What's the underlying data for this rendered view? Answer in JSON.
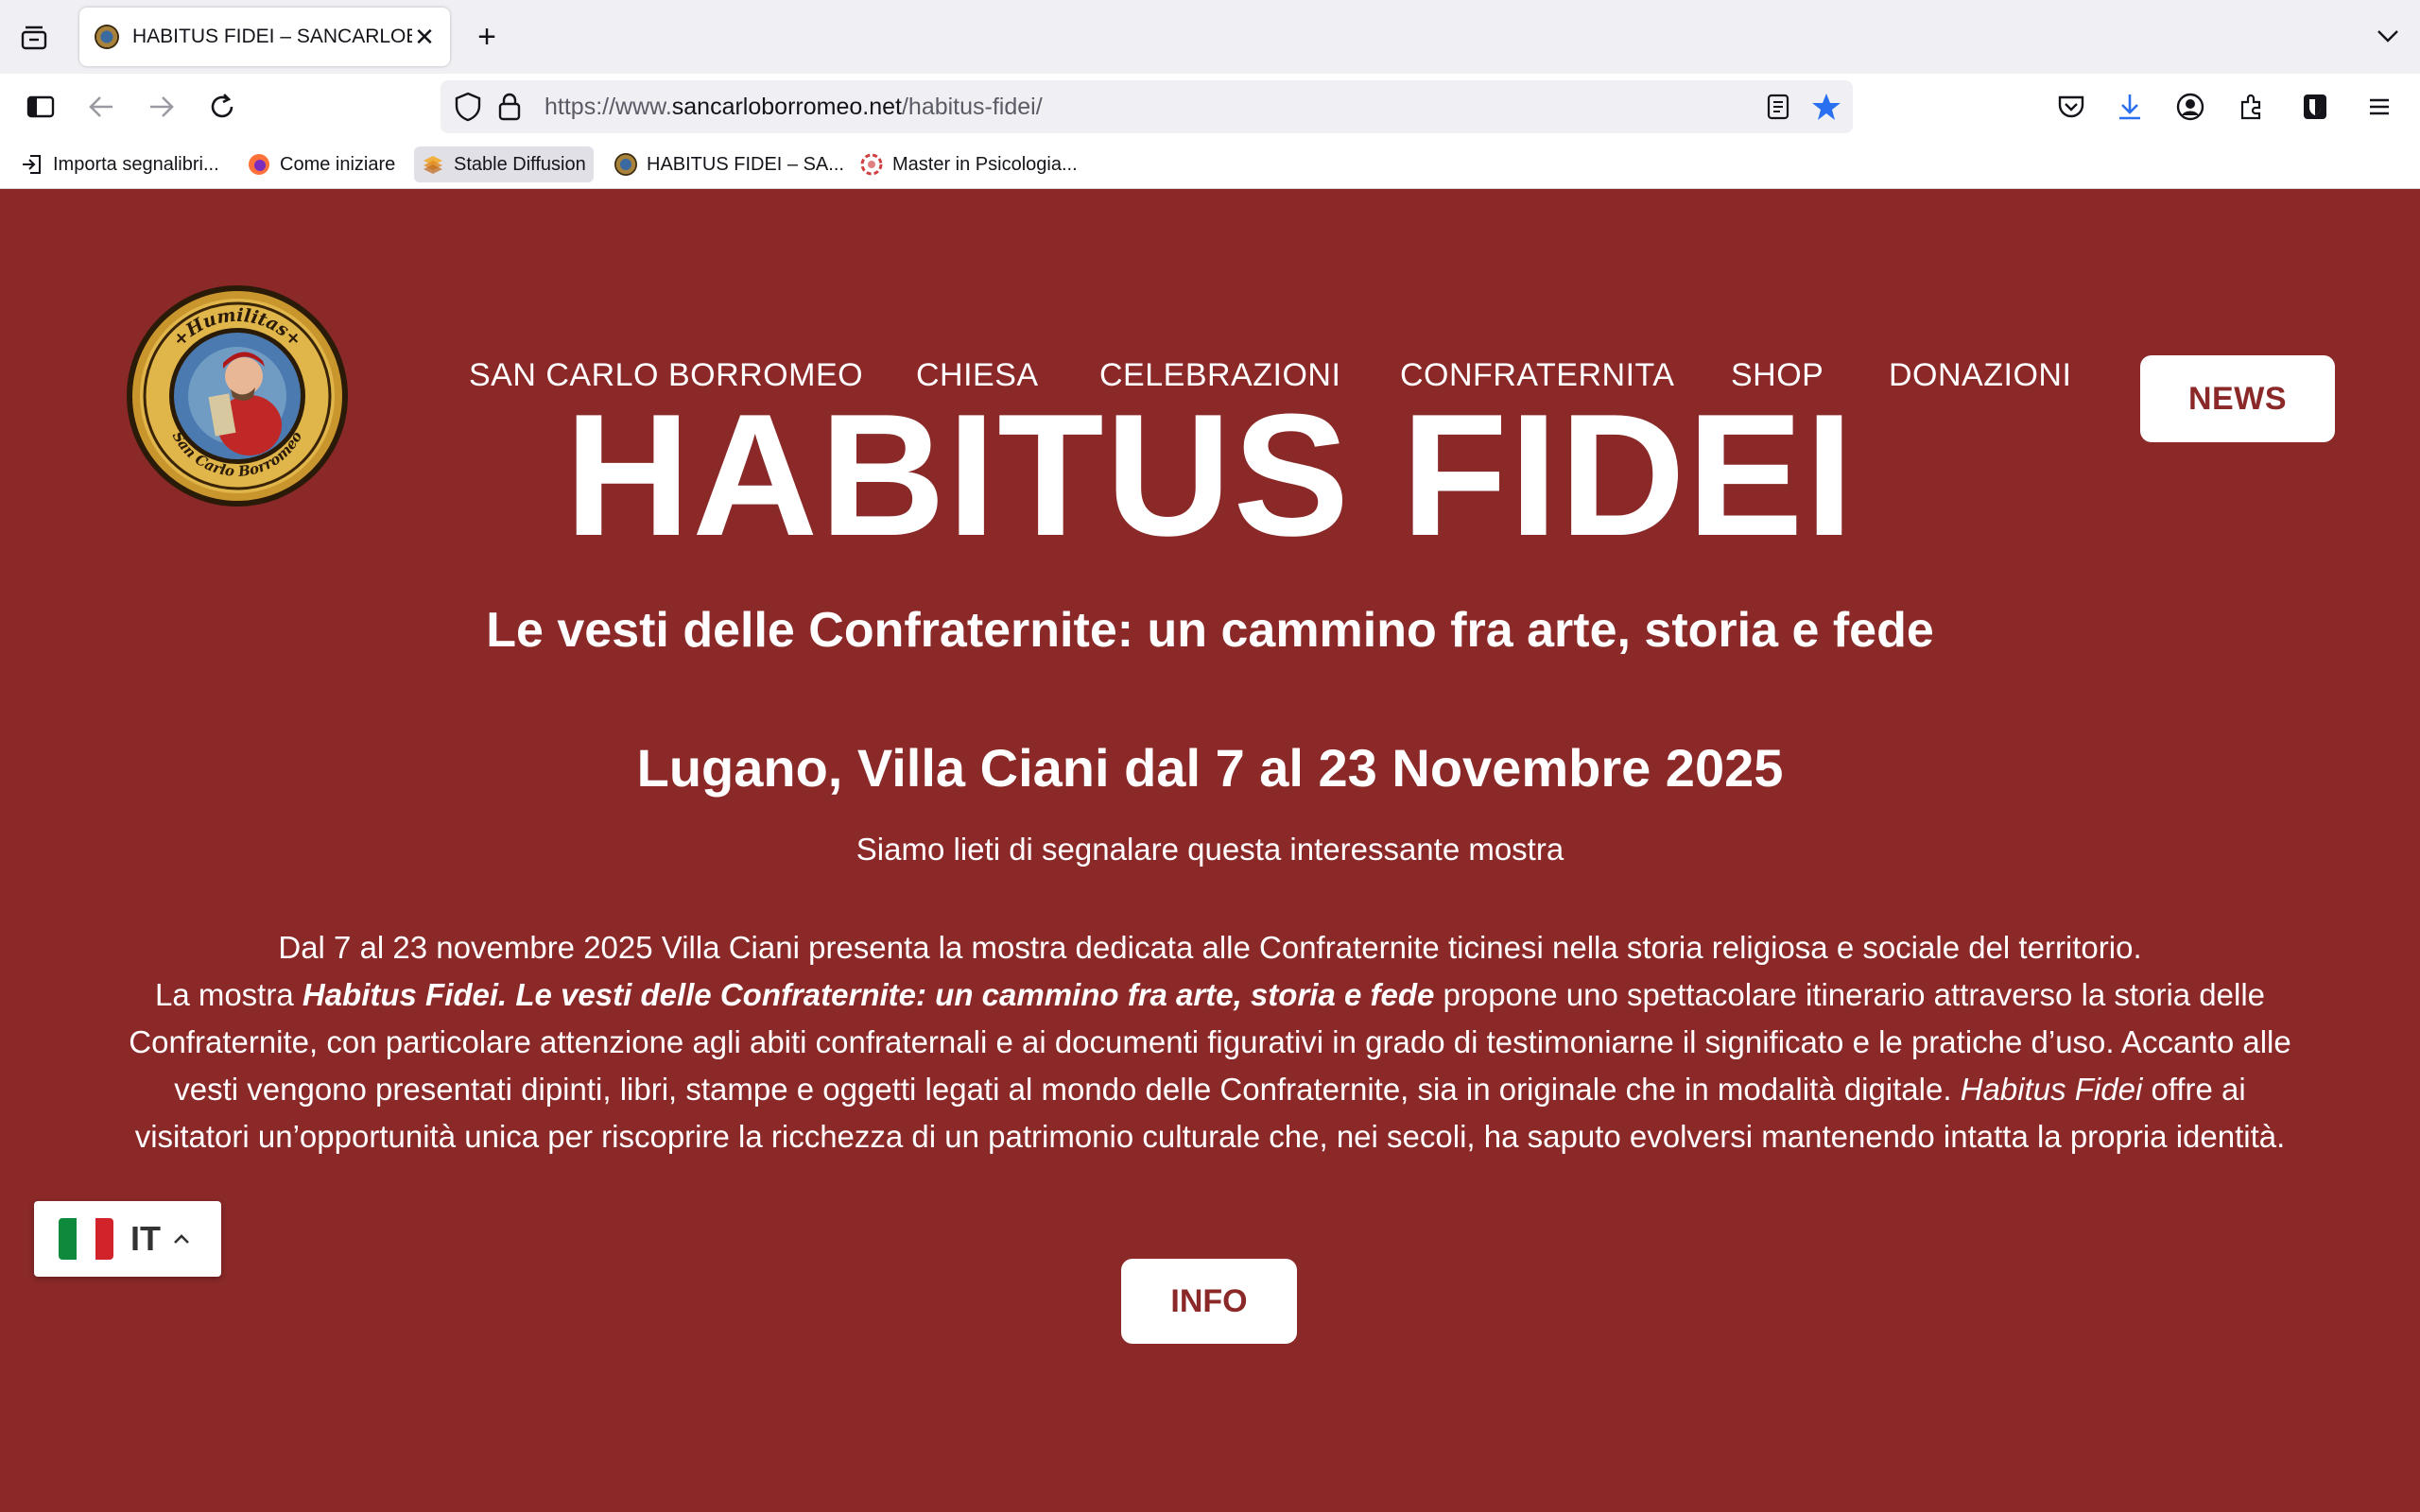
{
  "browser": {
    "tab": {
      "title": "HABITUS FIDEI – SANCARLOBO",
      "close": "✕"
    },
    "new_tab": "+",
    "url": {
      "prefix": "https://www.",
      "host": "sancarloborromeo.net",
      "path": "/habitus-fidei/"
    },
    "bookmarks": [
      {
        "label": "Importa segnalibri..."
      },
      {
        "label": "Come iniziare"
      },
      {
        "label": "Stable Diffusion"
      },
      {
        "label": "HABITUS FIDEI – SA..."
      },
      {
        "label": "Master in Psicologia..."
      }
    ]
  },
  "site": {
    "logo": {
      "top_text": "+Humilitas+",
      "bottom_text": "San Carlo Borromeo"
    },
    "menu": [
      "SAN CARLO BORROMEO",
      "CHIESA",
      "CELEBRAZIONI",
      "CONFRATERNITA",
      "SHOP",
      "DONAZIONI"
    ],
    "news_button": "NEWS",
    "title": "HABITUS FIDEI",
    "subtitle": "Le vesti delle Confraternite: un cammino fra arte, storia e fede",
    "place": "Lugano, Villa Ciani dal 7 al 23 Novembre 2025",
    "intro": "Siamo lieti di segnalare questa interessante mostra",
    "body": {
      "line1": "Dal 7 al 23 novembre 2025 Villa Ciani presenta la mostra dedicata alle Confraternite ticinesi nella storia religiosa e sociale del territorio.",
      "p2_start": "La mostra ",
      "p2_bold": "Habitus Fidei. Le vesti delle Confraternite: un cammino fra arte, storia e fede",
      "p2_mid": " propone uno spettacolare itinerario attraverso la storia delle Confraternite, con particolare attenzione agli abiti confraternali e ai documenti figurativi in grado di testimoniarne il significato e le pratiche d’uso. Accanto alle vesti vengono presentati dipinti, libri, stampe e oggetti legati al mondo delle Confraternite, sia in originale che in modalità digitale. ",
      "p2_italic": "Habitus Fidei",
      "p2_end": " offre ai visitatori un’opportunità unica per riscoprire la ricchezza di un patrimonio culturale che, nei secoli, ha saputo evolversi mantenendo intatta la propria identità."
    },
    "info_button": "INFO",
    "language": {
      "code": "IT",
      "flag_colors": [
        "#0f8a3c",
        "#ffffff",
        "#d2232a"
      ]
    }
  },
  "colors": {
    "brand": "#8b2828",
    "star": "#2a6ff0"
  }
}
